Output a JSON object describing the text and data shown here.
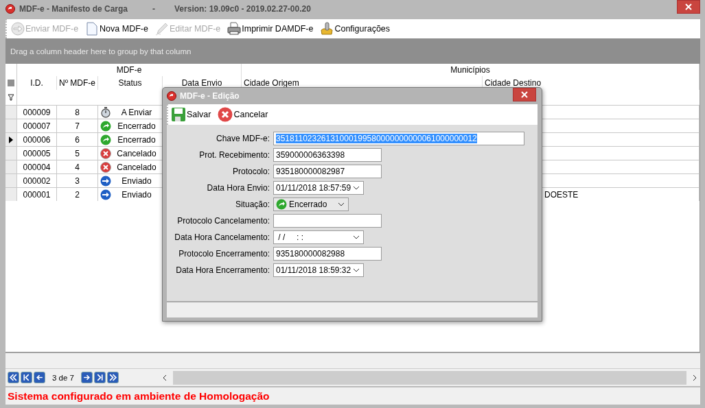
{
  "window": {
    "title": "MDF-e - Manifesto de Carga",
    "separator": "-",
    "version": "Version: 19.09c0 - 2019.02.27-00.20"
  },
  "toolbar": [
    {
      "kind": "send",
      "label": "Enviar MDF-e",
      "disabled": true
    },
    {
      "kind": "new",
      "label": "Nova MDF-e",
      "disabled": false
    },
    {
      "kind": "edit",
      "label": "Editar MDF-e",
      "disabled": true
    },
    {
      "kind": "print",
      "label": "Imprimir DAMDF-e",
      "disabled": false
    },
    {
      "kind": "settings",
      "label": "Configurações",
      "disabled": false
    }
  ],
  "group_panel": {
    "hint": "Drag a column header here to group by that column"
  },
  "table": {
    "bands": [
      "MDF-e",
      "Municípios"
    ],
    "columns": [
      "I.D.",
      "Nº MDF-e",
      "Status",
      "Data Envio",
      "Cidade Origem",
      "Cidade Destino"
    ],
    "rows": [
      {
        "id": "000009",
        "number": "8",
        "status": {
          "kind": "pending",
          "label": "A Enviar"
        },
        "selected": false
      },
      {
        "id": "000007",
        "number": "7",
        "status": {
          "kind": "closed",
          "label": "Encerrado"
        },
        "selected": false
      },
      {
        "id": "000006",
        "number": "6",
        "status": {
          "kind": "closed",
          "label": "Encerrado"
        },
        "selected": true
      },
      {
        "id": "000005",
        "number": "5",
        "status": {
          "kind": "cancelled",
          "label": "Cancelado"
        },
        "selected": false
      },
      {
        "id": "000004",
        "number": "4",
        "status": {
          "kind": "cancelled",
          "label": "Cancelado"
        },
        "selected": false
      },
      {
        "id": "000002",
        "number": "3",
        "status": {
          "kind": "sent",
          "label": "Enviado"
        },
        "selected": false
      },
      {
        "id": "000001",
        "number": "2",
        "status": {
          "kind": "sent",
          "label": "Enviado"
        },
        "selected": false,
        "cidade_destino": "DOESTE"
      }
    ]
  },
  "dialog": {
    "title": "MDF-e - Edição",
    "buttons": [
      {
        "kind": "save",
        "label": "Salvar"
      },
      {
        "kind": "cancel",
        "label": "Cancelar"
      }
    ],
    "fields": [
      {
        "kind": "wide",
        "label": "Chave MDF-e:",
        "value": "35181102326131000199580000000000061000000012",
        "highlighted": true
      },
      {
        "kind": "text",
        "label": "Prot. Recebimento:",
        "value": "359000006363398",
        "highlighted": false
      },
      {
        "kind": "text",
        "label": "Protocolo:",
        "value": "935180000082987",
        "highlighted": false
      },
      {
        "kind": "date",
        "label": "Data Hora Envio:",
        "value": "01/11/2018 18:57:59",
        "highlighted": false
      },
      {
        "kind": "status",
        "label": "Situação:",
        "status": {
          "kind": "closed",
          "label": "Encerrado"
        },
        "highlighted": false
      },
      {
        "kind": "text",
        "label": "Protocolo Cancelamento:",
        "highlighted": false
      },
      {
        "kind": "date",
        "label": "Data Hora Cancelamento:",
        "value": " / /     : :",
        "highlighted": false
      },
      {
        "kind": "text",
        "label": "Protocolo Encerramento:",
        "value": "935180000082988",
        "highlighted": false
      },
      {
        "kind": "date",
        "label": "Data Hora Encerramento:",
        "value": "01/11/2018 18:59:32",
        "highlighted": false
      }
    ]
  },
  "navigator": {
    "page": "3 de 7"
  },
  "status_bar": "Sistema configurado em ambiente de Homologação"
}
